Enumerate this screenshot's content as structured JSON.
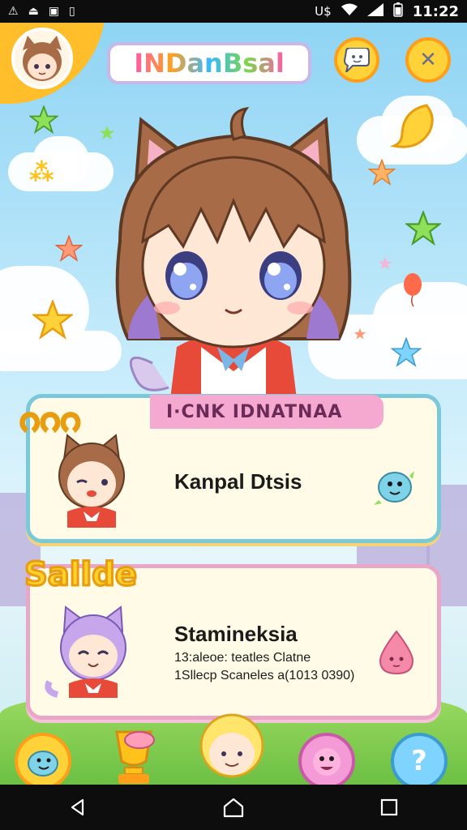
{
  "status_bar": {
    "left_icons": [
      "warning-icon",
      "upload-icon",
      "image-icon",
      "sim-icon"
    ],
    "carrier": "U$",
    "time": "11:22"
  },
  "header": {
    "game_title": "INDanBsal",
    "settings_icon": "speech-face-icon",
    "close_icon": "close-icon"
  },
  "cards": [
    {
      "badge": "ဂဂဂ",
      "ribbon": "I·CNK IDNATNAA",
      "name": "Kanpal Dtsis",
      "lines": [],
      "pet": "blue-dino-icon"
    },
    {
      "badge": "Sallde",
      "ribbon": "",
      "name": "Stamineksia",
      "lines": [
        "13:aleoe: teatles Clatne",
        "1Sllecp Scaneles a(1013 0390)"
      ],
      "pet": "pink-drop-icon"
    }
  ],
  "bottom_icons": [
    "blue-bird-icon",
    "gold-trophy-icon",
    "blonde-kid-icon",
    "pink-pig-icon",
    "question-icon"
  ],
  "colors": {
    "accent_yellow": "#ffd23a",
    "card1_border": "#7ac9d9",
    "card2_border": "#e9a6c6",
    "ribbon_pink": "#f6a9d0"
  }
}
